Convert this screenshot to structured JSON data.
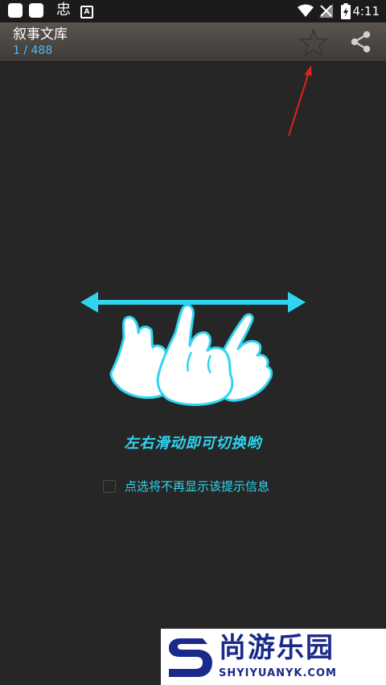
{
  "status_bar": {
    "glyph": "忠",
    "app_badge": "A",
    "time": "4:11",
    "icons": [
      "square-icon",
      "square-icon",
      "app-glyph-icon",
      "app-a-icon",
      "wifi-icon",
      "signal-muted-icon",
      "battery-charging-icon"
    ]
  },
  "app_bar": {
    "title": "叙事文库",
    "subtitle": "1 / 488",
    "subtitle_color": "#4fb7ff",
    "actions": [
      "star-icon",
      "share-icon"
    ]
  },
  "tutorial": {
    "gesture_icon": "swipe-hand-icon",
    "hint": "左右滑动即可切换哟",
    "dont_show_again": "点选将不再显示该提示信息",
    "dont_show_checked": false,
    "accent_color": "#2fd5ef"
  },
  "watermark": {
    "title": "尚游乐园",
    "url": "SHYIYUANYK.COM",
    "color": "#1a2a8a"
  }
}
